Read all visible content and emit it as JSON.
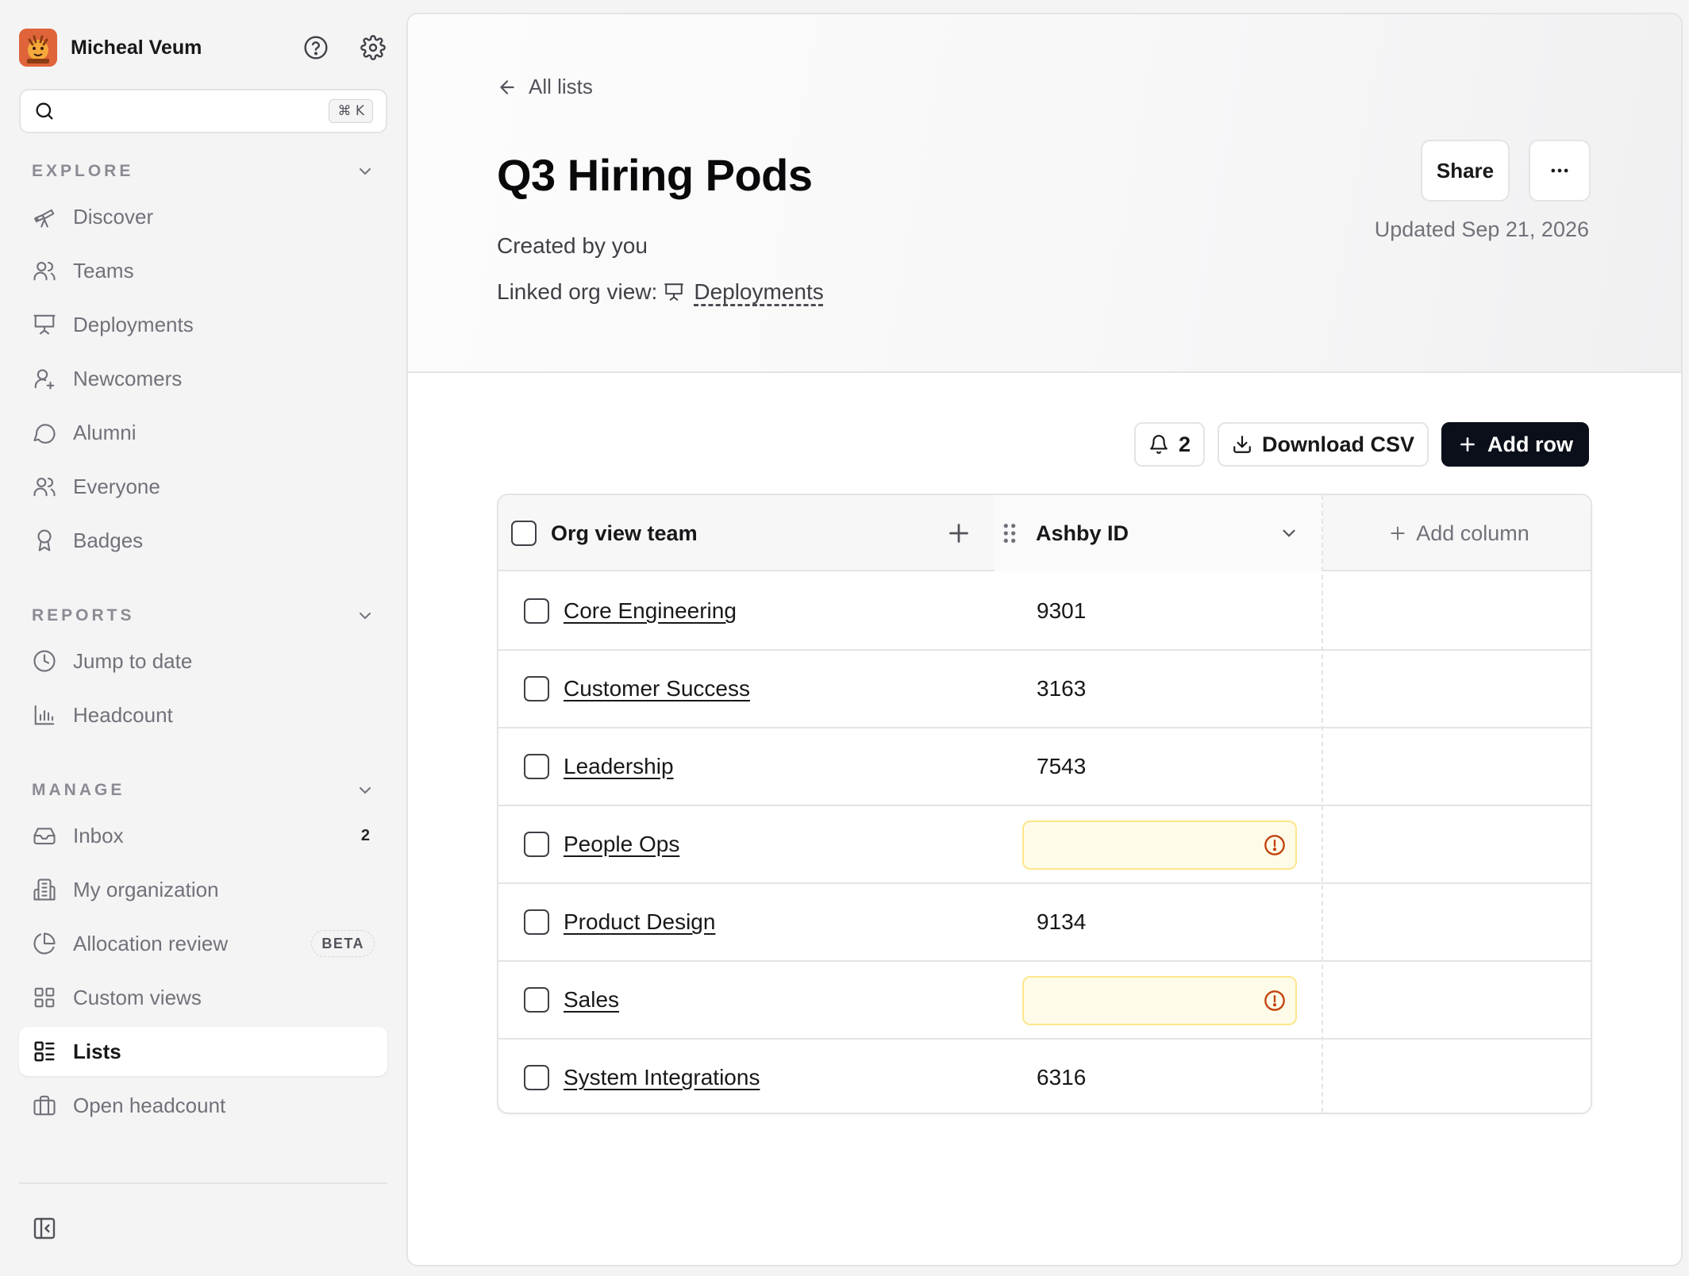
{
  "user": {
    "name": "Micheal Veum"
  },
  "search": {
    "placeholder": "",
    "shortcut": "⌘ K"
  },
  "sidebar": {
    "explore": {
      "title": "EXPLORE",
      "items": [
        {
          "label": "Discover",
          "icon": "telescope-icon"
        },
        {
          "label": "Teams",
          "icon": "users-icon"
        },
        {
          "label": "Deployments",
          "icon": "presentation-icon"
        },
        {
          "label": "Newcomers",
          "icon": "user-plus-icon"
        },
        {
          "label": "Alumni",
          "icon": "message-circle-icon"
        },
        {
          "label": "Everyone",
          "icon": "users-icon"
        },
        {
          "label": "Badges",
          "icon": "award-icon"
        }
      ]
    },
    "reports": {
      "title": "REPORTS",
      "items": [
        {
          "label": "Jump to date",
          "icon": "clock-icon"
        },
        {
          "label": "Headcount",
          "icon": "bar-chart-icon"
        }
      ]
    },
    "manage": {
      "title": "MANAGE",
      "items": [
        {
          "label": "Inbox",
          "icon": "inbox-icon",
          "count": "2"
        },
        {
          "label": "My organization",
          "icon": "building-icon"
        },
        {
          "label": "Allocation review",
          "icon": "pie-chart-icon",
          "badge": "BETA"
        },
        {
          "label": "Custom views",
          "icon": "grid-icon"
        },
        {
          "label": "Lists",
          "icon": "list-icon",
          "active": true
        },
        {
          "label": "Open headcount",
          "icon": "briefcase-icon"
        }
      ]
    }
  },
  "page": {
    "back_label": "All lists",
    "title": "Q3 Hiring Pods",
    "created": "Created by you",
    "linked_prefix": "Linked org view:",
    "linked_view": "Deployments",
    "share_label": "Share",
    "updated": "Updated Sep 21, 2026"
  },
  "toolbar": {
    "alerts_count": "2",
    "download_label": "Download CSV",
    "add_row_label": "Add row"
  },
  "table": {
    "columns": {
      "team": "Org view team",
      "ashby": "Ashby ID",
      "add": "Add column"
    },
    "rows": [
      {
        "team": "Core Engineering",
        "ashby_id": "9301",
        "missing": false
      },
      {
        "team": "Customer Success",
        "ashby_id": "3163",
        "missing": false
      },
      {
        "team": "Leadership",
        "ashby_id": "7543",
        "missing": false
      },
      {
        "team": "People Ops",
        "ashby_id": "",
        "missing": true
      },
      {
        "team": "Product Design",
        "ashby_id": "9134",
        "missing": false
      },
      {
        "team": "Sales",
        "ashby_id": "",
        "missing": true
      },
      {
        "team": "System Integrations",
        "ashby_id": "6316",
        "missing": false
      }
    ]
  },
  "colors": {
    "accent_dark": "#0b0f1a",
    "warning_bg": "#fefce8",
    "warning_border": "#fde68a",
    "warning_icon": "#c2410c"
  }
}
